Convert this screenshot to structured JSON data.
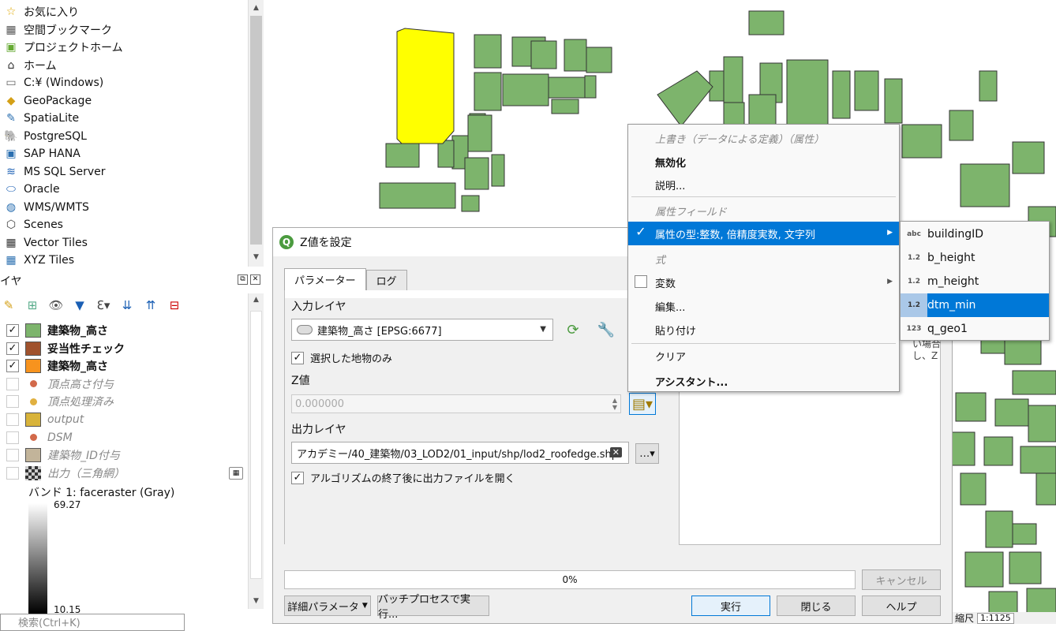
{
  "browser": {
    "items": [
      {
        "icon": "star-icon",
        "label": "お気に入り"
      },
      {
        "icon": "spatial-bookmark-icon",
        "label": "空間ブックマーク"
      },
      {
        "icon": "project-home-icon",
        "label": "プロジェクトホーム"
      },
      {
        "icon": "home-icon",
        "label": "ホーム"
      },
      {
        "icon": "folder-icon",
        "label": "C:¥ (Windows)"
      },
      {
        "icon": "geopackage-icon",
        "label": "GeoPackage"
      },
      {
        "icon": "spatialite-icon",
        "label": "SpatiaLite"
      },
      {
        "icon": "postgresql-icon",
        "label": "PostgreSQL"
      },
      {
        "icon": "sap-hana-icon",
        "label": "SAP HANA"
      },
      {
        "icon": "mssql-icon",
        "label": "MS SQL Server"
      },
      {
        "icon": "oracle-icon",
        "label": "Oracle"
      },
      {
        "icon": "wms-icon",
        "label": "WMS/WMTS"
      },
      {
        "icon": "scenes-icon",
        "label": "Scenes"
      },
      {
        "icon": "vector-tiles-icon",
        "label": "Vector Tiles"
      },
      {
        "icon": "xyz-tiles-icon",
        "label": "XYZ Tiles"
      }
    ]
  },
  "layers_panel": {
    "title": "イヤ",
    "layers": [
      {
        "checked": true,
        "symbol": "swatch",
        "color": "#7db46c",
        "label": "建築物_高さ",
        "style": "bold"
      },
      {
        "checked": true,
        "symbol": "swatch",
        "color": "#a0522d",
        "label": "妥当性チェック",
        "style": "bold"
      },
      {
        "checked": true,
        "symbol": "swatch",
        "color": "#f7931e",
        "label": "建築物_高さ",
        "style": "bold"
      },
      {
        "checked": false,
        "symbol": "dot",
        "color": "#d2694a",
        "label": "頂点高さ付与",
        "style": "italic"
      },
      {
        "checked": false,
        "symbol": "dot",
        "color": "#e0b040",
        "label": "頂点処理済み",
        "style": "italic"
      },
      {
        "checked": false,
        "symbol": "swatch",
        "color": "#d8b33a",
        "label": "output",
        "style": "italic"
      },
      {
        "checked": false,
        "symbol": "dot",
        "color": "#d2694a",
        "label": "DSM",
        "style": "italic"
      },
      {
        "checked": false,
        "symbol": "swatch",
        "color": "#c2b49a",
        "label": "建築物_ID付与",
        "style": "italic"
      },
      {
        "checked": false,
        "symbol": "raster",
        "color": "#333333",
        "label": "出力（三角網）",
        "style": "italic"
      }
    ],
    "band_label": "バンド 1: faceraster (Gray)",
    "gradient_max": "69.27",
    "gradient_min": "10.15",
    "search_placeholder": "検索(Ctrl+K)"
  },
  "dialog": {
    "title": "Z値を設定",
    "tabs": [
      "パラメーター",
      "ログ"
    ],
    "input_layer_label": "入力レイヤ",
    "input_layer_value": "建築物_高さ [EPSG:6677]",
    "selected_only_label": "選択した地物のみ",
    "selected_only_checked": true,
    "z_label": "Z値",
    "z_value": "0.000000",
    "output_layer_label": "出力レイヤ",
    "output_layer_value": "アカデミー/40_建築物/03_LOD2/01_input/shp/lod2_roofedge.shp",
    "open_output_label": "アルゴリズムの終了後に出力ファイルを開く",
    "open_output_checked": true,
    "help_text_1": "い場合",
    "help_text_2": "し、Z",
    "progress": "0%",
    "cancel": "キャンセル",
    "advanced": "詳細パラメータ",
    "batch": "バッチプロセスで実行...",
    "run": "実行",
    "close": "閉じる",
    "help": "ヘルプ"
  },
  "context_menu": {
    "header": "上書き（データによる定義）（属性）",
    "disable": "無効化",
    "description": "説明...",
    "attr_field_header": "属性フィールド",
    "attr_type": "属性の型:整数, 倍精度実数, 文字列",
    "expression_header": "式",
    "variable": "変数",
    "edit": "編集...",
    "paste": "貼り付け",
    "clear": "クリア",
    "assistant": "アシスタント..."
  },
  "fields_submenu": {
    "fields": [
      {
        "type": "abc",
        "name": "buildingID"
      },
      {
        "type": "1.2",
        "name": "b_height"
      },
      {
        "type": "1.2",
        "name": "m_height"
      },
      {
        "type": "1.2",
        "name": "dtm_min"
      },
      {
        "type": "123",
        "name": "q_geo1"
      }
    ],
    "highlighted": "dtm_min"
  },
  "status": {
    "scale_label": "縮尺",
    "scale_value": "1:1125"
  },
  "colors": {
    "building_fill": "#7db46c",
    "selected_fill": "#ffff00",
    "highlight": "#0078d7"
  }
}
